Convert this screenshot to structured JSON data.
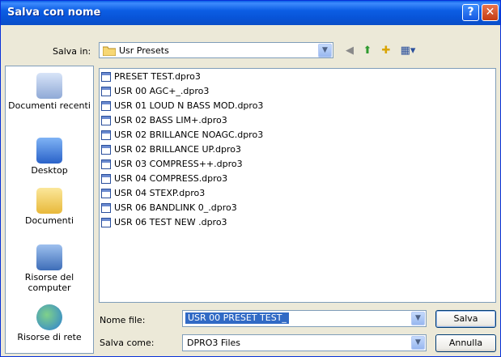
{
  "window": {
    "title": "Salva con nome"
  },
  "toolbar": {
    "save_in_label": "Salva in:",
    "save_in_value": "Usr Presets"
  },
  "places": [
    {
      "label": "Documenti recenti",
      "icon": "recent-documents-icon"
    },
    {
      "label": "Desktop",
      "icon": "desktop-icon"
    },
    {
      "label": "Documenti",
      "icon": "documents-folder-icon"
    },
    {
      "label": "Risorse del computer",
      "icon": "my-computer-icon"
    },
    {
      "label": "Risorse di rete",
      "icon": "network-icon"
    }
  ],
  "files": [
    "PRESET TEST.dpro3",
    "USR 00 AGC+_.dpro3",
    "USR 01 LOUD N BASS MOD.dpro3",
    "USR 02 BASS LIM+.dpro3",
    "USR 02 BRILLANCE NOAGC.dpro3",
    "USR 02 BRILLANCE UP.dpro3",
    "USR 03 COMPRESS++.dpro3",
    "USR 04 COMPRESS.dpro3",
    "USR 04 STEXP.dpro3",
    "USR 06 BANDLINK 0_.dpro3",
    "USR 06 TEST NEW .dpro3"
  ],
  "form": {
    "file_name_label": "Nome file:",
    "file_name_value": "USR 00 PRESET TEST_",
    "save_as_label": "Salva come:",
    "save_as_value": "DPRO3 Files"
  },
  "buttons": {
    "save": "Salva",
    "cancel": "Annulla"
  },
  "colors": {
    "titlebar": "#0a5fe6",
    "selection": "#316ac5",
    "close": "#c43b12"
  }
}
